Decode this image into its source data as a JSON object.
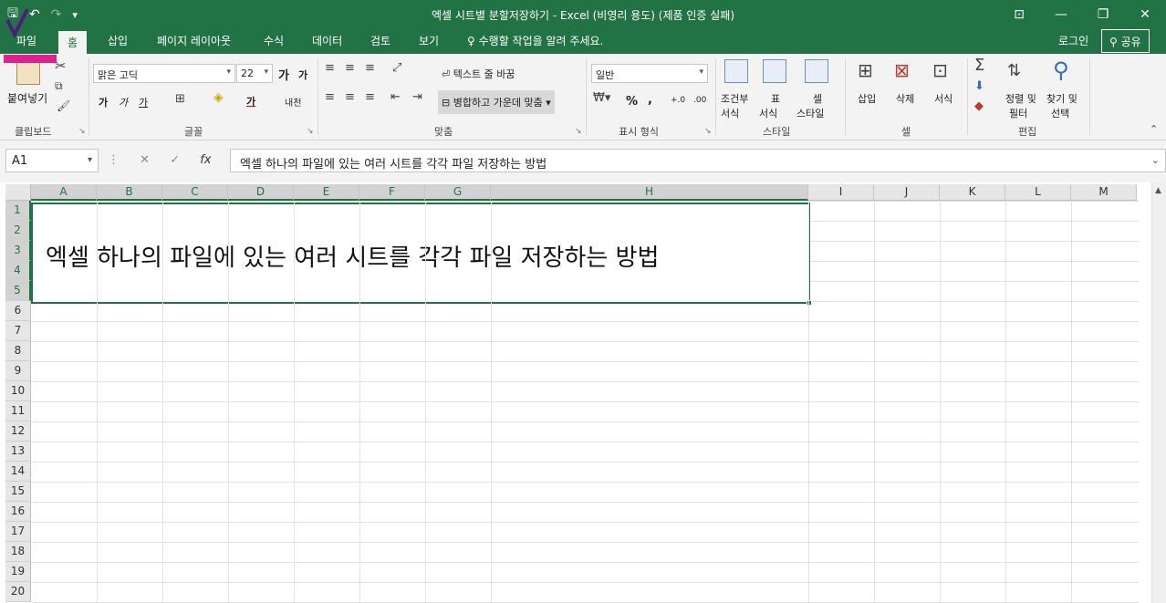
{
  "title_bar": {
    "title": "엑셀 시트별 분할저장하기 - Excel (비영리 용도) (제품 인증 실패)",
    "qat": [
      "save-icon",
      "undo-icon",
      "redo-icon",
      "customize-icon"
    ]
  },
  "menu": {
    "tabs": [
      "파일",
      "홈",
      "삽입",
      "페이지 레이아웃",
      "수식",
      "데이터",
      "검토",
      "보기"
    ],
    "active_tab": "홈",
    "tell_me": "수행할 작업을 알려 주세요.",
    "sign_in": "로그인",
    "share": "공유"
  },
  "ribbon": {
    "clipboard": {
      "paste": "붙여넣기",
      "label": "클립보드"
    },
    "font": {
      "name": "맑은 고딕",
      "size": "22",
      "grow": "가",
      "shrink": "가",
      "bold": "가",
      "italic": "가",
      "underline": "가",
      "font_color": "가",
      "phonetic": "내천",
      "label": "글꼴"
    },
    "alignment": {
      "wrap": "텍스트 줄 바꿈",
      "merge": "병합하고 가운데 맞춤",
      "label": "맞춤"
    },
    "number": {
      "format": "일반",
      "percent": "%",
      "comma": ",",
      "inc_decimal": "+.0",
      "dec_decimal": ".00",
      "label": "표시 형식"
    },
    "styles": {
      "conditional": "조건부",
      "conditional_sub": "서식",
      "table": "표",
      "table_sub": "서식",
      "cell": "셀",
      "cell_sub": "스타일",
      "label": "스타일"
    },
    "cells": {
      "insert": "삽입",
      "delete": "삭제",
      "format": "서식",
      "label": "셀"
    },
    "editing": {
      "sort": "정렬 및",
      "sort_sub": "필터",
      "find": "찾기 및",
      "find_sub": "선택",
      "label": "편집"
    }
  },
  "formula_bar": {
    "name_box": "A1",
    "fx": "fx",
    "content": "엑셀 하나의 파일에 있는 여러 시트를 각각 파일 저장하는 방법"
  },
  "grid": {
    "columns": [
      "A",
      "B",
      "C",
      "D",
      "E",
      "F",
      "G",
      "H",
      "I",
      "J",
      "K",
      "L",
      "M"
    ],
    "rows": [
      "1",
      "2",
      "3",
      "4",
      "5",
      "6",
      "7",
      "8",
      "9",
      "10",
      "11",
      "12",
      "13",
      "14",
      "15",
      "16",
      "17",
      "18",
      "19",
      "20"
    ],
    "merged_text": "엑셀 하나의 파일에 있는 여러 시트를 각각 파일 저장하는 방법"
  },
  "colors": {
    "accent": "#217346",
    "pen": "#e0208c"
  }
}
